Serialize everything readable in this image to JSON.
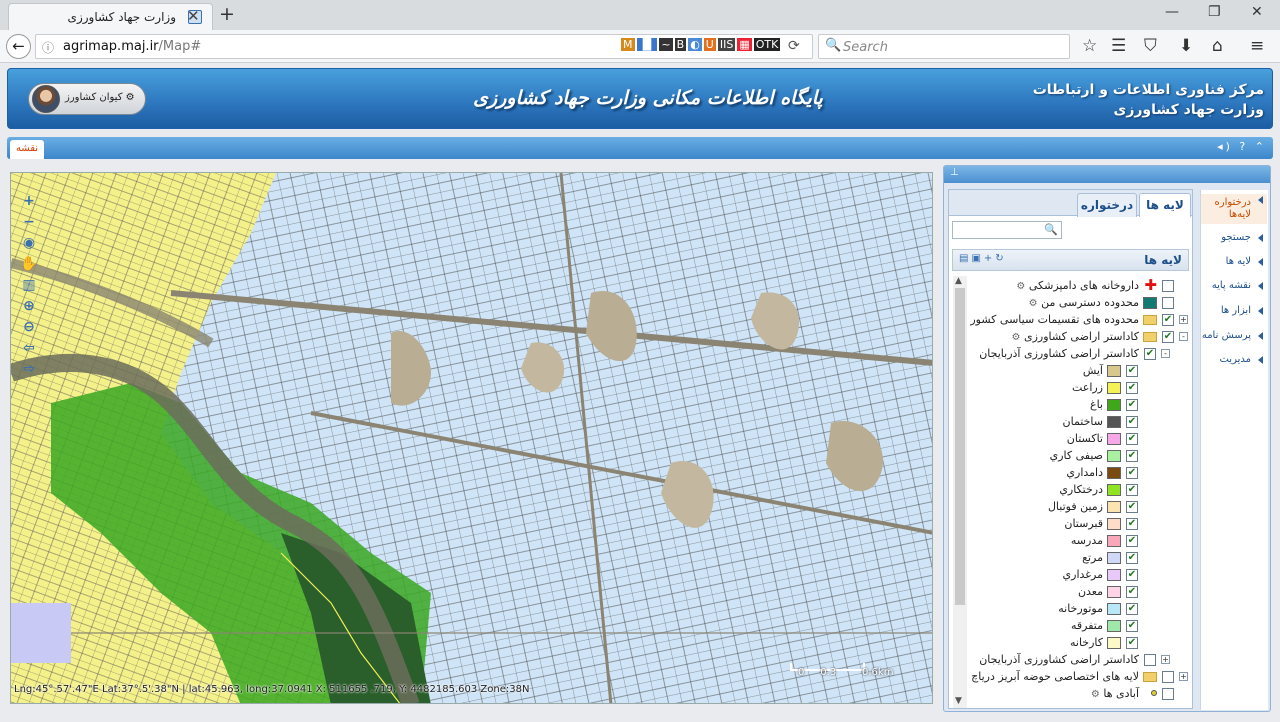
{
  "browser": {
    "tab_title": "وزارت جهاد کشاورزی",
    "url_host": "agrimap.maj.ir",
    "url_path": "/Map#",
    "search_placeholder": "Search",
    "extensions": [
      "M",
      "▐▌",
      "~",
      "B",
      "◐",
      "U",
      "IIS",
      "▦",
      "OTK"
    ]
  },
  "header": {
    "title": "پایگاه اطلاعات مکانی وزارت جهاد کشاورزی",
    "org_line1": "مرکز فناوری اطلاعات و ارتباطات",
    "org_line2": "وزارت جهاد کشاورزی",
    "user_name": "کیوان کشاورز"
  },
  "tabs": {
    "map": "نقشه"
  },
  "map": {
    "coords": "Lng:45°.57'.47\"E Lat:37°.5'.38\"N | lat:45.963, long:37.0941 X: 511655 .719, Y: 4482185.603 Zone:38N",
    "scale_start": "0",
    "scale_mid": "0.3",
    "scale_end": "0.6km"
  },
  "sidenav": [
    {
      "label": "درختواره لایه‌ها",
      "active": true
    },
    {
      "label": "جستجو",
      "active": false
    },
    {
      "label": "لایه ها",
      "active": false
    },
    {
      "label": "نقشه پایه",
      "active": false
    },
    {
      "label": "ابزار ها",
      "active": false
    },
    {
      "label": "پرسش نامه",
      "active": false
    },
    {
      "label": "مدیریت",
      "active": false
    }
  ],
  "layer_panel": {
    "tab_layers": "لایه ها",
    "tab_tree": "درختواره",
    "header": "لایه ها",
    "rows": [
      {
        "label": "داروخانه های دامپزشکی",
        "level": 0,
        "checked": false,
        "swatch": "cross",
        "gear": true
      },
      {
        "label": "محدوده دسترسی من",
        "level": 0,
        "checked": false,
        "swatch": "#137a72",
        "gear": true
      },
      {
        "label": "محدوده های تقسیمات سیاسی کشور",
        "level": 0,
        "checked": true,
        "swatch": "folder",
        "expand": "+"
      },
      {
        "label": "کاداستر اراضی کشاورزی",
        "level": 0,
        "checked": true,
        "swatch": "folder",
        "gear": true,
        "expand": "-"
      },
      {
        "label": "کاداستر اراضی کشاورزی آذربایجان",
        "level": 1,
        "checked": true,
        "swatch": "",
        "expand": "-"
      },
      {
        "label": "آیش",
        "level": 2,
        "checked": true,
        "swatch": "#d8c88c"
      },
      {
        "label": "زراعت",
        "level": 2,
        "checked": true,
        "swatch": "#f5f256"
      },
      {
        "label": "باغ",
        "level": 2,
        "checked": true,
        "swatch": "#3ea818"
      },
      {
        "label": "ساختمان",
        "level": 2,
        "checked": true,
        "swatch": "#555555"
      },
      {
        "label": "تاکستان",
        "level": 2,
        "checked": true,
        "swatch": "#f7a8e8"
      },
      {
        "label": "صیفی کاري",
        "level": 2,
        "checked": true,
        "swatch": "#a8f0a0"
      },
      {
        "label": "دامداري",
        "level": 2,
        "checked": true,
        "swatch": "#7a4a10"
      },
      {
        "label": "درختکاري",
        "level": 2,
        "checked": true,
        "swatch": "#8ee420"
      },
      {
        "label": "زمین فوتبال",
        "level": 2,
        "checked": true,
        "swatch": "#fbe4b0"
      },
      {
        "label": "قبرستان",
        "level": 2,
        "checked": true,
        "swatch": "#fddcc8"
      },
      {
        "label": "مدرسه",
        "level": 2,
        "checked": true,
        "swatch": "#f8a8b8"
      },
      {
        "label": "مرتع",
        "level": 2,
        "checked": true,
        "swatch": "#d0d8f8"
      },
      {
        "label": "مرغداري",
        "level": 2,
        "checked": true,
        "swatch": "#e8c8f8"
      },
      {
        "label": "معدن",
        "level": 2,
        "checked": true,
        "swatch": "#fcd4e8"
      },
      {
        "label": "موتورخانه",
        "level": 2,
        "checked": true,
        "swatch": "#b8e8f8"
      },
      {
        "label": "متفرقه",
        "level": 2,
        "checked": true,
        "swatch": "#a0e8a8"
      },
      {
        "label": "کارخانه",
        "level": 2,
        "checked": true,
        "swatch": "#fdf8c8"
      },
      {
        "label": "کاداستر اراضی کشاورزی آذربایجان",
        "level": 1,
        "checked": false,
        "swatch": "",
        "expand": "+"
      },
      {
        "label": "لایه های اختصاصی حوضه آبریز دریاچ",
        "level": 0,
        "checked": false,
        "swatch": "folder",
        "expand": "+"
      },
      {
        "label": "آبادی ها",
        "level": 0,
        "checked": false,
        "swatch": "dot",
        "gear": true
      }
    ]
  }
}
